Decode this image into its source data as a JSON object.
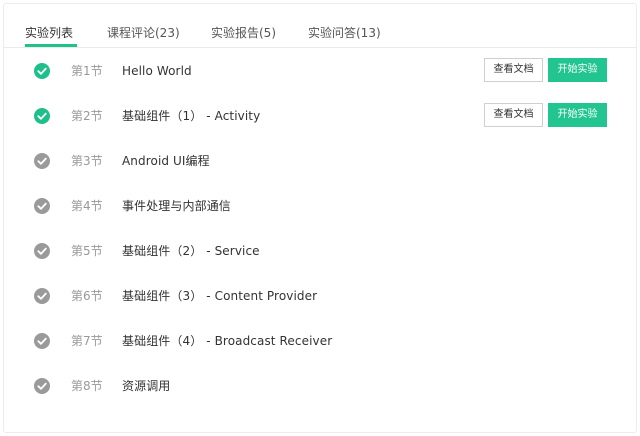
{
  "tabs": [
    {
      "label": "实验列表",
      "active": true
    },
    {
      "label": "课程评论(23)",
      "active": false
    },
    {
      "label": "实验报告(5)",
      "active": false
    },
    {
      "label": "实验问答(13)",
      "active": false
    }
  ],
  "colors": {
    "accent": "#1fc28d",
    "done_check": "#1fbf8c",
    "pending_check": "#9a9a9a"
  },
  "lessons": [
    {
      "section": "第1节",
      "title": "Hello World",
      "completed": true,
      "doc_label": "查看文档",
      "start_label": "开始实验"
    },
    {
      "section": "第2节",
      "title": "基础组件（1） - Activity",
      "completed": true,
      "doc_label": "查看文档",
      "start_label": "开始实验"
    },
    {
      "section": "第3节",
      "title": "Android UI编程",
      "completed": false
    },
    {
      "section": "第4节",
      "title": "事件处理与内部通信",
      "completed": false
    },
    {
      "section": "第5节",
      "title": "基础组件（2） - Service",
      "completed": false
    },
    {
      "section": "第6节",
      "title": "基础组件（3） - Content Provider",
      "completed": false
    },
    {
      "section": "第7节",
      "title": "基础组件（4） - Broadcast Receiver",
      "completed": false
    },
    {
      "section": "第8节",
      "title": "资源调用",
      "completed": false
    }
  ]
}
